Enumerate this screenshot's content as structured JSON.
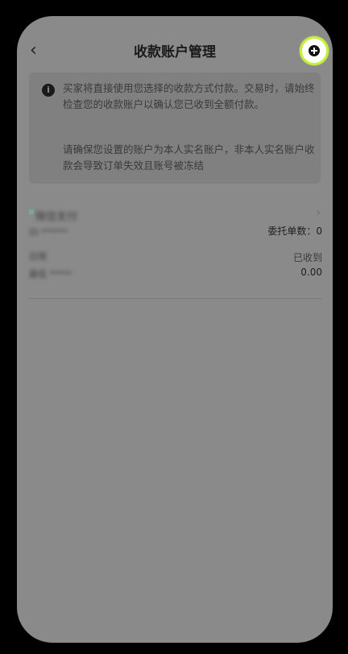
{
  "header": {
    "back_icon": "chevron-left-icon",
    "title": "收款账户管理",
    "add_icon": "plus-circle-icon",
    "accent_color": "#c5f03d"
  },
  "notice": {
    "icon": "info-icon",
    "line1": "买家将直接使用您选择的收款方式付款。交易时，请始终检查您的收款账户以确认您已收到全额付款。",
    "line2": "请确保您设置的账户为本人实名账户，非本人实名账户收款会导致订单失效且账号被冻结"
  },
  "account": {
    "name_blurred": "微信支付",
    "id_blurred": "ID  ******",
    "label1_blurred": "日限",
    "label2_blurred": "最低  *****",
    "order_count_label": "委托单数：0",
    "received_label": "已收到",
    "amount": "0.00",
    "chevron_icon": "chevron-right-icon"
  }
}
